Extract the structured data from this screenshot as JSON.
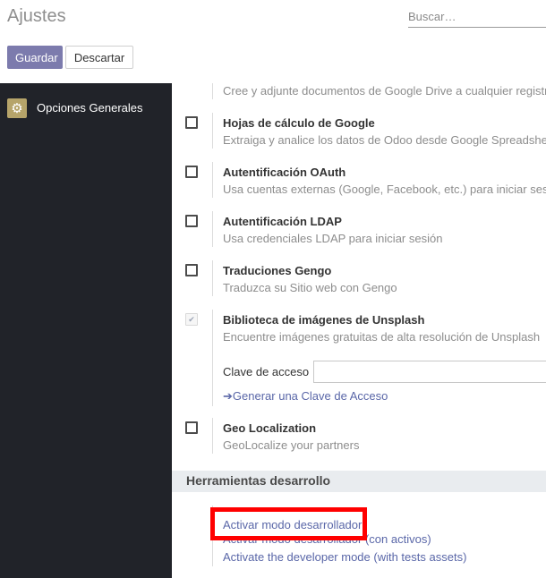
{
  "header": {
    "title": "Ajustes",
    "search_placeholder": "Buscar…",
    "save_label": "Guardar",
    "discard_label": "Descartar"
  },
  "sidebar": {
    "items": [
      {
        "label": "Opciones Generales",
        "icon": "gear-icon"
      }
    ]
  },
  "settings": {
    "google_drive_desc": "Cree y adjunte documentos de Google Drive a cualquier registro",
    "items": [
      {
        "title": "Hojas de cálculo de Google",
        "desc": "Extraiga y analice los datos de Odoo desde Google Spreadsheet",
        "checked": false
      },
      {
        "title": "Autentificación OAuth",
        "desc": "Usa cuentas externas (Google, Facebook, etc.) para iniciar sesión",
        "checked": false
      },
      {
        "title": "Autentificación LDAP",
        "desc": "Usa credenciales LDAP para iniciar sesión",
        "checked": false
      },
      {
        "title": "Traduciones Gengo",
        "desc": "Traduzca su Sitio web con Gengo",
        "checked": false
      },
      {
        "title": "Biblioteca de imágenes de Unsplash",
        "desc": "Encuentre imágenes gratuitas de alta resolución de Unsplash",
        "checked": true
      },
      {
        "title": "Geo Localization",
        "desc": "GeoLocalize your partners",
        "checked": false
      }
    ],
    "unsplash": {
      "access_key_label": "Clave de acceso",
      "access_key_value": "",
      "generate_link": "Generar una Clave de Acceso"
    }
  },
  "dev_tools": {
    "section_title": "Herramientas desarrollo",
    "links": [
      "Activar modo desarrollador",
      "Activar modo desarrollador (con activos)",
      "Activate the developer mode (with tests assets)"
    ],
    "highlight_color": "#ff0000"
  },
  "colors": {
    "primary": "#7c7bad",
    "sidebar_bg": "#212329",
    "link": "#5a67a8"
  }
}
